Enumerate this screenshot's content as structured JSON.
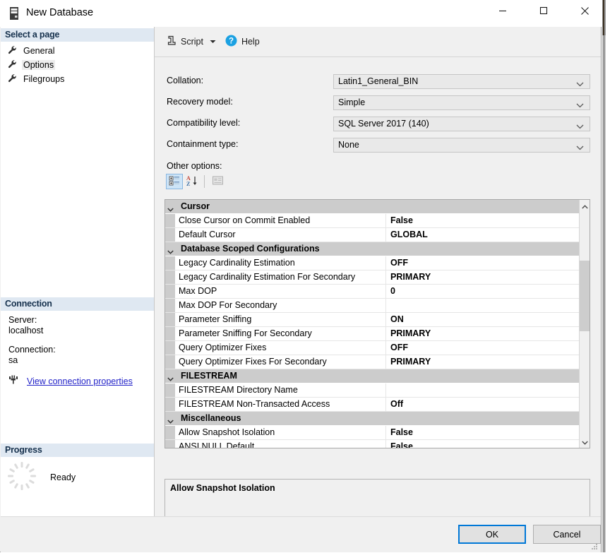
{
  "window": {
    "title": "New Database",
    "icon": "server-icon",
    "controls": {
      "minimize": "minimize-icon",
      "maximize": "maximize-icon",
      "close": "close-icon"
    }
  },
  "sidebar": {
    "select_page_header": "Select a page",
    "pages": [
      {
        "label": "General",
        "icon": "wrench-icon",
        "selected": false
      },
      {
        "label": "Options",
        "icon": "wrench-icon",
        "selected": true
      },
      {
        "label": "Filegroups",
        "icon": "wrench-icon",
        "selected": false
      }
    ],
    "connection_header": "Connection",
    "server_label": "Server:",
    "server_value": "localhost",
    "connection_label": "Connection:",
    "connection_value": "sa",
    "view_connection_link": "View connection properties",
    "connection_link_icon": "plug-icon",
    "progress_header": "Progress",
    "progress_status": "Ready",
    "progress_icon": "spinner-icon"
  },
  "toolbar": {
    "script_label": "Script",
    "script_icon": "script-icon",
    "dropdown_icon": "chevron-down-icon",
    "help_label": "Help",
    "help_icon": "help-circle-icon"
  },
  "form": {
    "fields": [
      {
        "label": "Collation:",
        "value": "Latin1_General_BIN"
      },
      {
        "label": "Recovery model:",
        "value": "Simple"
      },
      {
        "label": "Compatibility level:",
        "value": "SQL Server 2017 (140)"
      },
      {
        "label": "Containment type:",
        "value": "None"
      }
    ],
    "other_options_label": "Other options:"
  },
  "grid_toolbar": {
    "buttons": [
      {
        "name": "categorized-view-button",
        "icon": "categorized-icon",
        "active": true,
        "enabled": true
      },
      {
        "name": "alphabetical-sort-button",
        "icon": "sort-az-icon",
        "active": false,
        "enabled": true
      },
      {
        "name": "property-pages-button",
        "icon": "property-page-icon",
        "active": false,
        "enabled": false
      }
    ]
  },
  "property_grid": {
    "rows": [
      {
        "type": "category",
        "name": "Cursor"
      },
      {
        "type": "property",
        "name": "Close Cursor on Commit Enabled",
        "value": "False"
      },
      {
        "type": "property",
        "name": "Default Cursor",
        "value": "GLOBAL"
      },
      {
        "type": "category",
        "name": "Database Scoped Configurations"
      },
      {
        "type": "property",
        "name": "Legacy Cardinality Estimation",
        "value": "OFF"
      },
      {
        "type": "property",
        "name": "Legacy Cardinality Estimation For Secondary",
        "value": "PRIMARY"
      },
      {
        "type": "property",
        "name": "Max DOP",
        "value": "0"
      },
      {
        "type": "property",
        "name": "Max DOP For Secondary",
        "value": ""
      },
      {
        "type": "property",
        "name": "Parameter Sniffing",
        "value": "ON"
      },
      {
        "type": "property",
        "name": "Parameter Sniffing For Secondary",
        "value": "PRIMARY"
      },
      {
        "type": "property",
        "name": "Query Optimizer Fixes",
        "value": "OFF"
      },
      {
        "type": "property",
        "name": "Query Optimizer Fixes For Secondary",
        "value": "PRIMARY"
      },
      {
        "type": "category",
        "name": "FILESTREAM"
      },
      {
        "type": "property",
        "name": "FILESTREAM Directory Name",
        "value": ""
      },
      {
        "type": "property",
        "name": "FILESTREAM Non-Transacted Access",
        "value": "Off"
      },
      {
        "type": "category",
        "name": "Miscellaneous"
      },
      {
        "type": "property",
        "name": "Allow Snapshot Isolation",
        "value": "False"
      },
      {
        "type": "property",
        "name": "ANSI NULL Default",
        "value": "False"
      }
    ],
    "scrollbar": {
      "up_icon": "chevron-up-icon",
      "down_icon": "chevron-down-icon"
    }
  },
  "description": {
    "title": "Allow Snapshot Isolation"
  },
  "footer": {
    "ok_label": "OK",
    "cancel_label": "Cancel"
  },
  "colors": {
    "accent": "#0078d7",
    "link": "#2323c8",
    "section_header_bg": "#dfe8f2",
    "category_row_bg": "#cccccc"
  }
}
